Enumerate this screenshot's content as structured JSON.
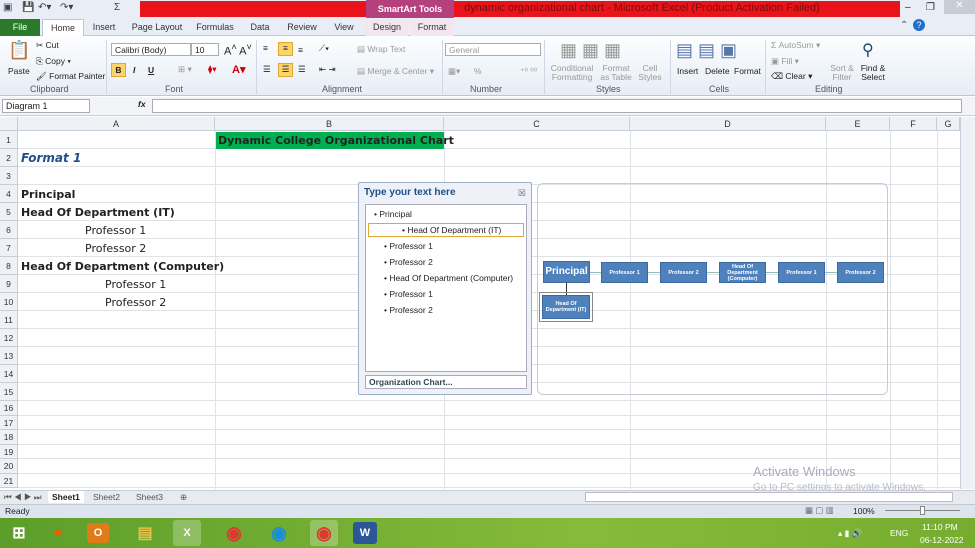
{
  "window": {
    "title": "dynamic organizational chart  -  Microsoft Excel (Product Activation Failed)",
    "contextual_tab": "SmartArt Tools"
  },
  "tabs": [
    "File",
    "Home",
    "Insert",
    "Page Layout",
    "Formulas",
    "Data",
    "Review",
    "View",
    "Design",
    "Format"
  ],
  "ribbon": {
    "clipboard": {
      "paste": "Paste",
      "cut": "Cut",
      "copy": "Copy",
      "format_painter": "Format Painter",
      "label": "Clipboard"
    },
    "font": {
      "name": "Calibri (Body)",
      "size": "10",
      "bold": "B",
      "italic": "I",
      "underline": "U",
      "label": "Font"
    },
    "alignment": {
      "wrap": "Wrap Text",
      "merge": "Merge & Center",
      "label": "Alignment"
    },
    "number": {
      "format": "General",
      "percent": "%",
      "label": "Number"
    },
    "styles": {
      "conditional": "Conditional Formatting",
      "format_table": "Format as Table",
      "cell_styles": "Cell Styles",
      "label": "Styles"
    },
    "cells": {
      "insert": "Insert",
      "delete": "Delete",
      "format": "Format",
      "label": "Cells"
    },
    "editing": {
      "autosum": "AutoSum",
      "fill": "Fill",
      "clear": "Clear",
      "sort": "Sort & Filter",
      "find": "Find & Select",
      "label": "Editing"
    }
  },
  "formula_bar": {
    "name_box": "Diagram 1",
    "fx": "fx",
    "value": ""
  },
  "columns": [
    "A",
    "B",
    "C",
    "D",
    "E",
    "F",
    "G"
  ],
  "rows": [
    "1",
    "2",
    "3",
    "4",
    "5",
    "6",
    "7",
    "8",
    "9",
    "10",
    "11",
    "12",
    "13",
    "14",
    "15",
    "16",
    "17",
    "18",
    "19",
    "20",
    "21"
  ],
  "cells": {
    "B1": "Dynamic College Organizational Chart",
    "A2": "Format 1",
    "A4": "Principal",
    "A5": "Head Of Department (IT)",
    "A6": "Professor 1",
    "A7": "Professor 2",
    "A8": "Head Of Department (Computer)",
    "A9": "Professor 1",
    "A10": "Professor 2"
  },
  "text_pane": {
    "title": "Type your text here",
    "items": [
      "Principal",
      "Head Of Department (IT)",
      "Professor 1",
      "Professor 2",
      "Head Of Department (Computer)",
      "Professor 1",
      "Professor 2"
    ],
    "footer": "Organization Chart..."
  },
  "smartart": {
    "top": "Principal",
    "selected": "Head Of Department (IT)",
    "nodes": [
      "Professor 1",
      "Professor 2",
      "Head Of Department (Computer)",
      "Professor 1",
      "Professor 2"
    ],
    "fill_color": "#4f81bd"
  },
  "sheets": [
    "Sheet1",
    "Sheet2",
    "Sheet3"
  ],
  "status": {
    "text": "Ready",
    "zoom": "100%"
  },
  "watermark": {
    "line1": "Activate Windows",
    "line2": "Go to PC settings to activate Windows."
  },
  "taskbar": {
    "lang": "ENG",
    "time": "11:10 PM",
    "date": "06-12-2022"
  },
  "colors": {
    "title_fill": "#00b050",
    "accent_red": "#e8141a"
  }
}
